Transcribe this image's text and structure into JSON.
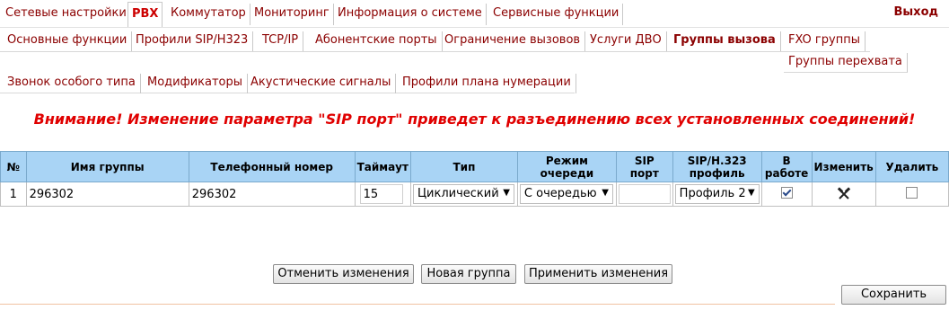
{
  "top_nav": {
    "tabs": [
      {
        "label": "Сетевые настройки"
      },
      {
        "label": "PBX"
      },
      {
        "label": "Коммутатор"
      },
      {
        "label": "Мониторинг"
      },
      {
        "label": "Информация о системе"
      },
      {
        "label": "Сервисные функции"
      }
    ],
    "exit_label": "Выход"
  },
  "sub_nav": {
    "tabs": [
      {
        "label": "Основные функции"
      },
      {
        "label": "Профили SIP/H323"
      },
      {
        "label": "TCP/IP"
      },
      {
        "label": "Абонентские порты"
      },
      {
        "label": "Ограничение вызовов"
      },
      {
        "label": "Услуги ДВО"
      },
      {
        "label": "Группы вызова"
      },
      {
        "label": "FXO группы"
      },
      {
        "label": "Группы перехвата"
      },
      {
        "label": "Звонок особого типа"
      },
      {
        "label": "Модификаторы"
      },
      {
        "label": "Акустические сигналы"
      },
      {
        "label": "Профили плана нумерации"
      }
    ],
    "active": "Группы вызова"
  },
  "warning": "Внимание! Изменение параметра \"SIP порт\" приведет к разъединению всех установленных соединений!",
  "table": {
    "headers": {
      "num": "№",
      "name": "Имя группы",
      "phone": "Телефонный номер",
      "timeout": "Таймаут",
      "type": "Тип",
      "queue_line1": "Режим",
      "queue_line2": "очереди",
      "sip_port": "SIP порт",
      "profile_line1": "SIP/H.323",
      "profile_line2": "профиль",
      "active_line1": "В",
      "active_line2": "работе",
      "edit": "Изменить",
      "delete": "Удалить"
    },
    "rows": [
      {
        "num": "1",
        "name": "296302",
        "phone": "296302",
        "timeout": "15",
        "type": "Циклический",
        "queue": "С очередью",
        "sip_port": "",
        "profile": "Профиль 2",
        "active": true,
        "edit_icon": "tools-icon",
        "delete": false
      }
    ]
  },
  "buttons": {
    "cancel": "Отменить изменения",
    "new_group": "Новая группа",
    "apply": "Применить изменения",
    "save": "Сохранить"
  },
  "colors": {
    "link": "#8b0000",
    "warning": "#e00000",
    "table_header": "#a9d4f5"
  }
}
